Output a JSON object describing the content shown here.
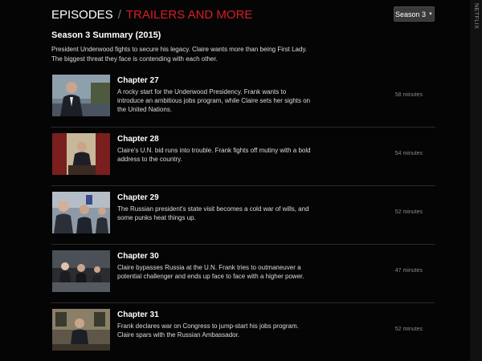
{
  "header": {
    "episodes_tab": "EPISODES",
    "separator": "/",
    "trailers_tab": "TRAILERS AND MORE",
    "season_selector": "Season 3",
    "accent_color": "#d81e26"
  },
  "summary": {
    "title": "Season 3 Summary (2015)",
    "text": "President Underwood fights to secure his legacy. Claire wants more than being First Lady. The biggest threat they face is contending with each other."
  },
  "episodes": [
    {
      "title": "Chapter 27",
      "description": "A rocky start for the Underwood Presidency. Frank wants to introduce an ambitious jobs program, while Claire sets her sights on the United Nations.",
      "duration": "58 minutes"
    },
    {
      "title": "Chapter 28",
      "description": "Claire's U.N. bid runs into trouble. Frank fights off mutiny with a bold address to the country.",
      "duration": "54 minutes"
    },
    {
      "title": "Chapter 29",
      "description": "The Russian president's state visit becomes a cold war of wills, and some punks heat things up.",
      "duration": "52 minutes"
    },
    {
      "title": "Chapter 30",
      "description": "Claire bypasses Russia at the U.N. Frank tries to outmaneuver a potential challenger and ends up face to face with a higher power.",
      "duration": "47 minutes"
    },
    {
      "title": "Chapter 31",
      "description": "Frank declares war on Congress to jump-start his jobs program. Claire spars with the Russian Ambassador.",
      "duration": "52 minutes"
    }
  ],
  "watermark": "NETFLIX"
}
